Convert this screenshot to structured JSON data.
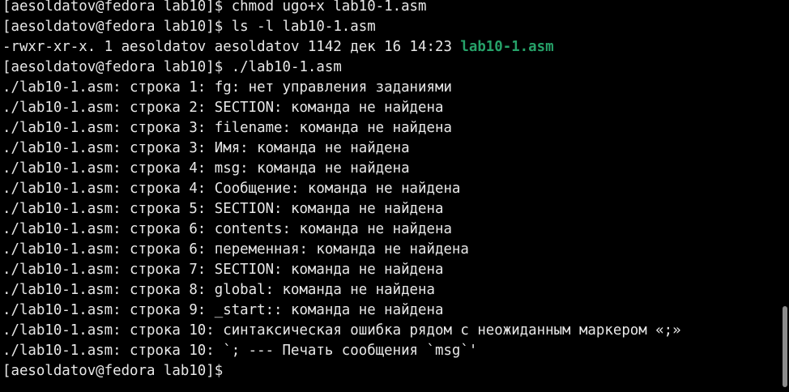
{
  "terminal": {
    "lines": [
      "[aesoldatov@fedora lab10]$ chmod ugo+x lab10-1.asm",
      "[aesoldatov@fedora lab10]$ ls -l lab10-1.asm",
      "./lab10-1.asm: строка 1: fg: нет управления заданиями",
      "./lab10-1.asm: строка 2: SECTION: команда не найдена",
      "./lab10-1.asm: строка 3: filename: команда не найдена",
      "./lab10-1.asm: строка 3: Имя: команда не найдена",
      "./lab10-1.asm: строка 4: msg: команда не найдена",
      "./lab10-1.asm: строка 4: Сообщение: команда не найдена",
      "./lab10-1.asm: строка 5: SECTION: команда не найдена",
      "./lab10-1.asm: строка 6: contents: команда не найдена",
      "./lab10-1.asm: строка 6: переменная: команда не найдена",
      "./lab10-1.asm: строка 7: SECTION: команда не найдена",
      "./lab10-1.asm: строка 8: global: команда не найдена",
      "./lab10-1.asm: строка 9: _start:: команда не найдена",
      "./lab10-1.asm: строка 10: синтаксическая ошибка рядом с неожиданным маркером «;»",
      "./lab10-1.asm: строка 10: `; --- Печать сообщения `msg`'",
      "[aesoldatov@fedora lab10]$"
    ],
    "listing": {
      "perms_and_meta": "-rwxr-xr-x. 1 aesoldatov aesoldatov 1142 дек 16 14:23 ",
      "filename": "lab10-1.asm"
    },
    "run_command": "[aesoldatov@fedora lab10]$ ./lab10-1.asm"
  },
  "colors": {
    "background": "#000000",
    "text": "#e8e8e8",
    "executable": "#26a269",
    "scrollbar_thumb": "#8c8c8c"
  }
}
